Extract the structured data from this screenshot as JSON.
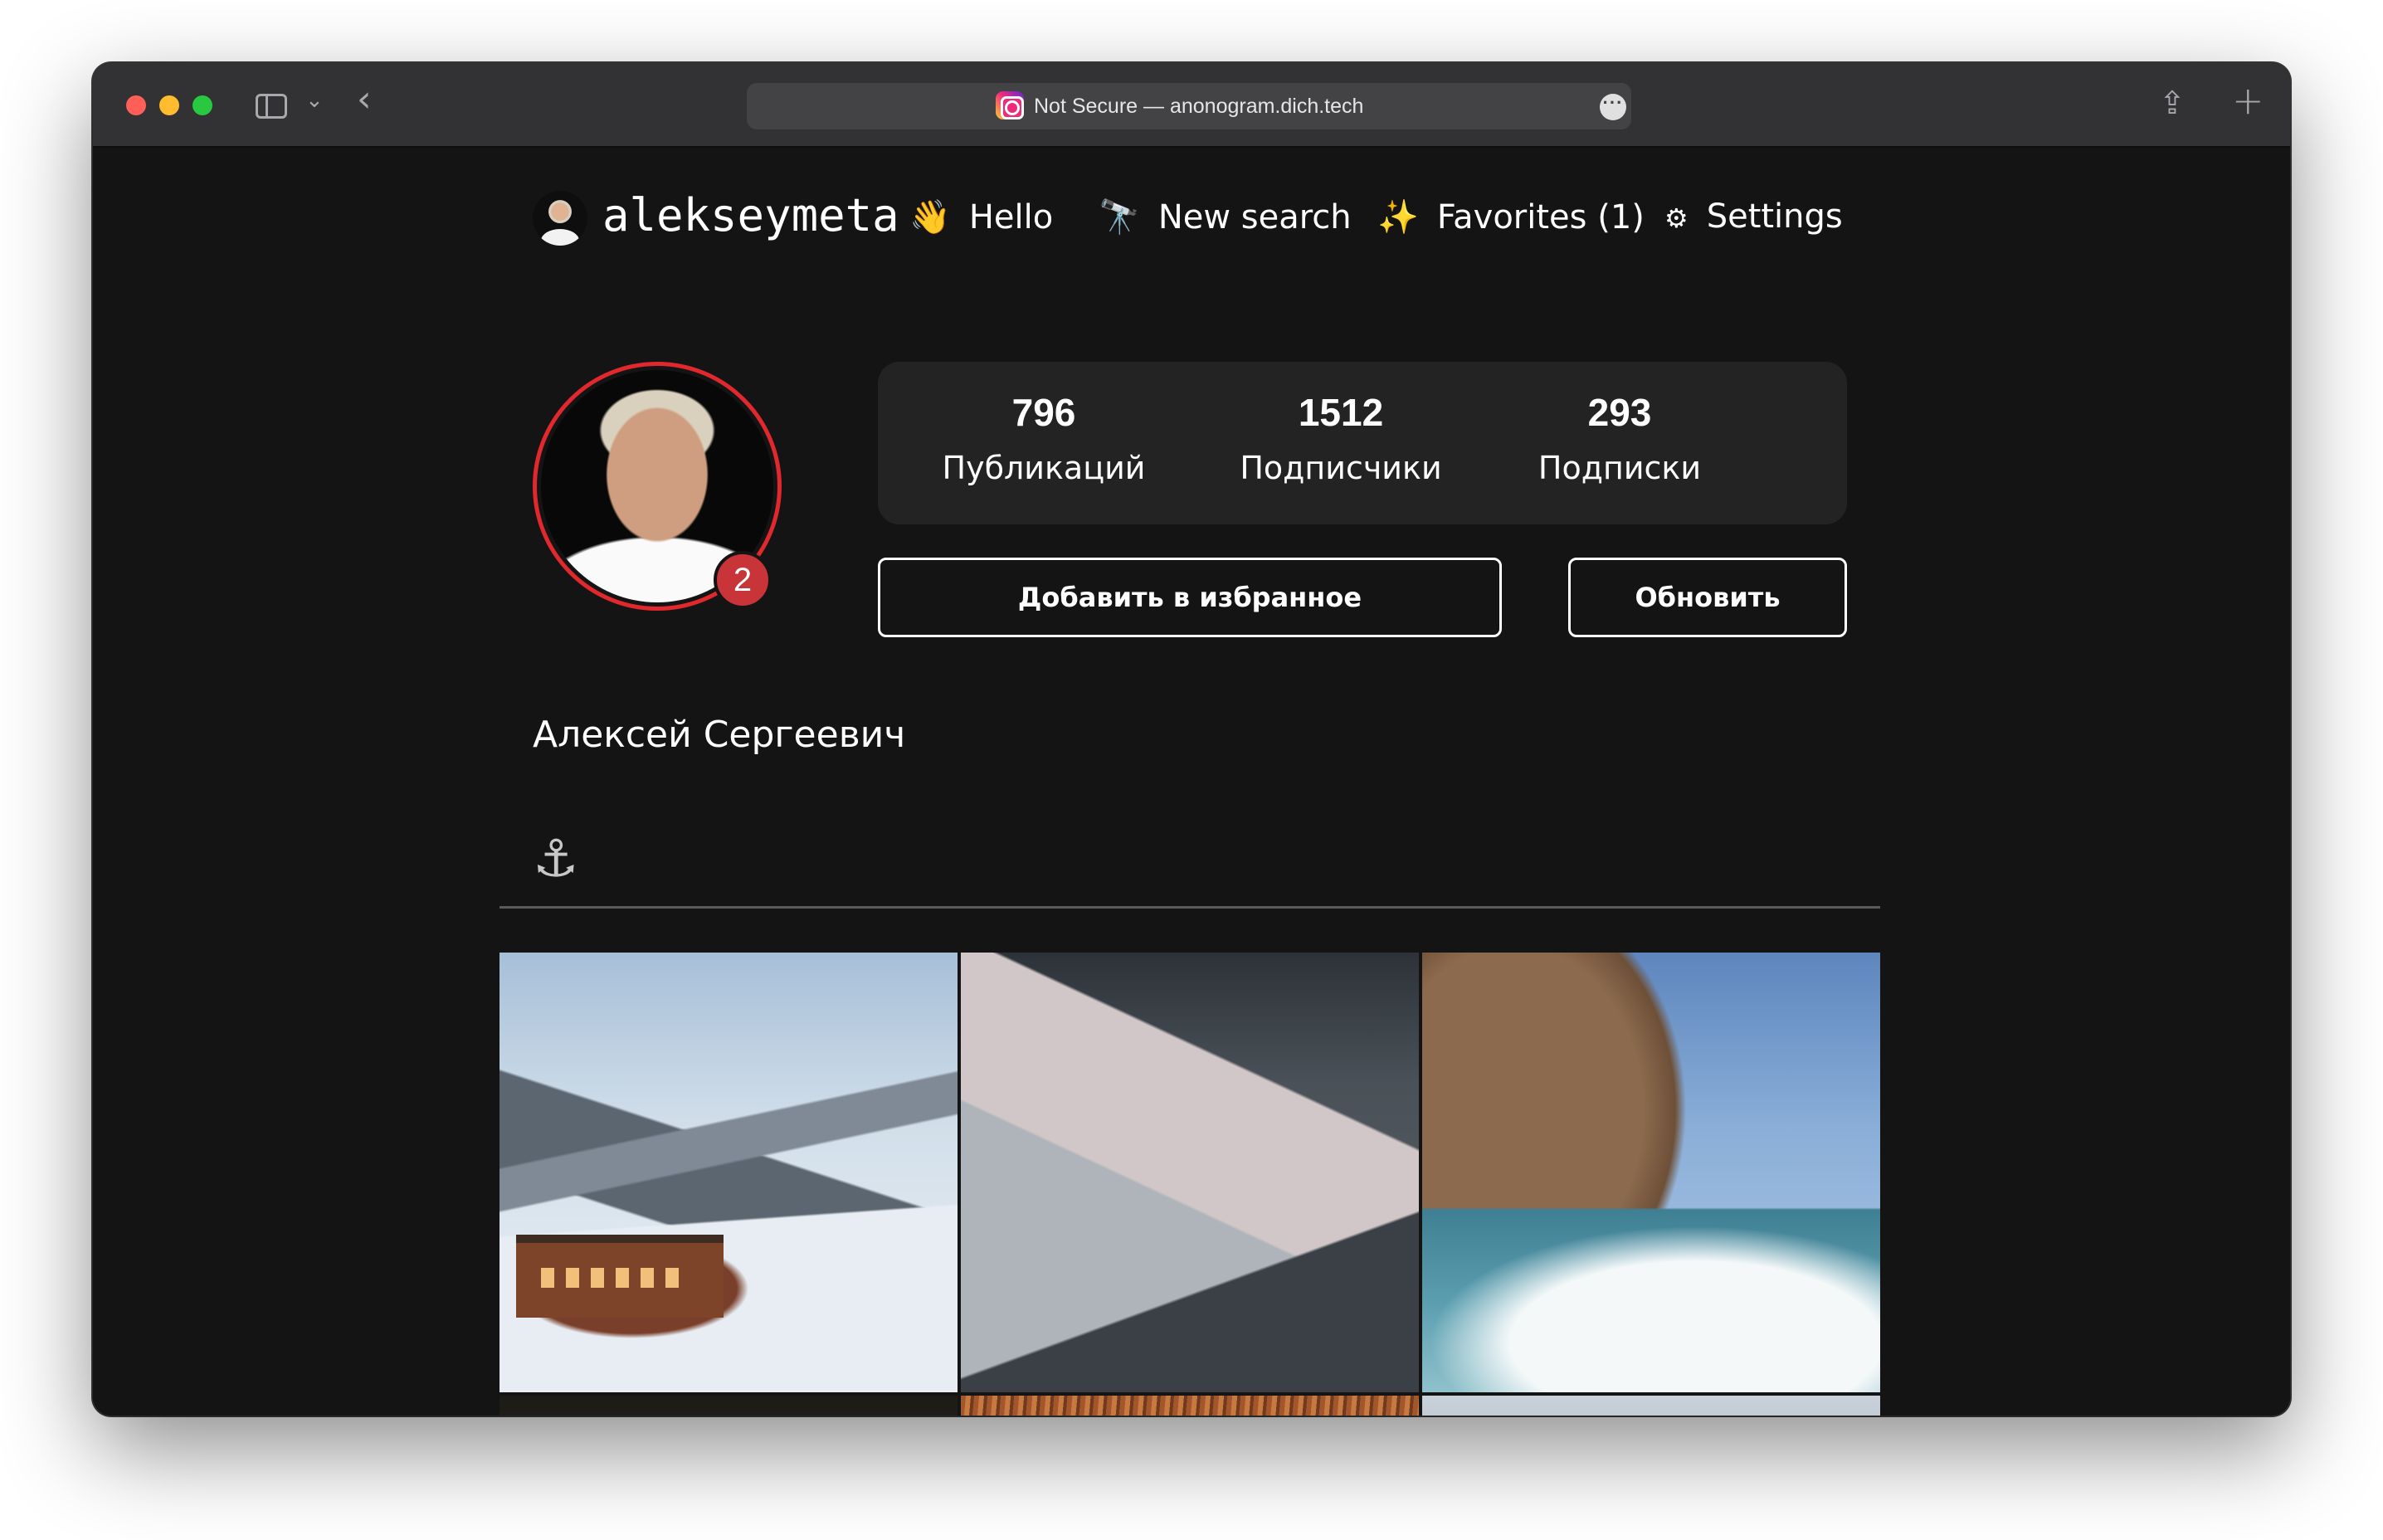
{
  "browser": {
    "url_text": "Not Secure — anonogram.dich.tech",
    "icons": {
      "sidebar": "sidebar-toggle-icon",
      "chevron": "chevron-down-icon",
      "back": "back-arrow-icon",
      "site": "instagram-favicon",
      "more": "ellipsis-icon",
      "share": "share-icon",
      "new_tab": "plus-icon"
    },
    "icon_glyphs": {
      "chevron": "⌄",
      "back": "‹",
      "more": "···",
      "share": "⇪",
      "new_tab": "+"
    }
  },
  "nav": {
    "username": "alekseymeta",
    "hello": {
      "emoji": "👋",
      "label": "Hello"
    },
    "new_search": {
      "emoji": "🔭",
      "label": "New search"
    },
    "favorites": {
      "emoji": "✨",
      "label": "Favorites (1)"
    },
    "settings": {
      "emoji": "⚙",
      "label": "Settings"
    }
  },
  "profile": {
    "stories_badge": "2",
    "stats": [
      {
        "value": "796",
        "label": "Публикаций"
      },
      {
        "value": "1512",
        "label": "Подписчики"
      },
      {
        "value": "293",
        "label": "Подписки"
      }
    ],
    "add_favorite_label": "Добавить в избранное",
    "refresh_label": "Обновить",
    "full_name": "Алексей Сергеевич",
    "bio_symbol": "⚓"
  },
  "colors": {
    "page_bg": "#141414",
    "stats_bg": "#232323",
    "story_ring": "#e0282d",
    "badge": "#c93439",
    "text": "#ffffff"
  },
  "posts": [
    {
      "subject": "snowy-valley-cabin"
    },
    {
      "subject": "snow-ridge"
    },
    {
      "subject": "sea-rock-waves"
    },
    {
      "subject": "dark-close-up"
    },
    {
      "subject": "orange-grass"
    },
    {
      "subject": "grey-sky"
    }
  ]
}
